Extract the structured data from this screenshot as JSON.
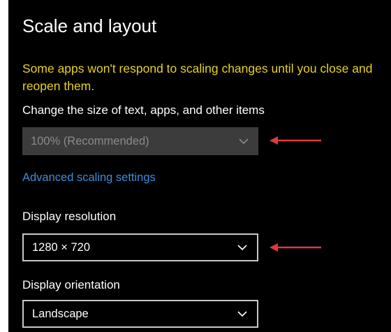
{
  "section": {
    "title": "Scale and layout",
    "warning": "Some apps won't respond to scaling changes until you close and reopen them."
  },
  "scale": {
    "label": "Change the size of text, apps, and other items",
    "selected": "100% (Recommended)",
    "enabled": false
  },
  "advanced_link": "Advanced scaling settings",
  "resolution": {
    "label": "Display resolution",
    "selected": "1280 × 720"
  },
  "orientation": {
    "label": "Display orientation",
    "selected": "Landscape"
  },
  "icons": {
    "dropdown": "chevron-down-icon",
    "annotation": "red-arrow-icon"
  },
  "colors": {
    "background": "#000000",
    "warning_text": "#e6d21e",
    "link": "#3b8ed8",
    "annotation_arrow": "#e0393e"
  }
}
